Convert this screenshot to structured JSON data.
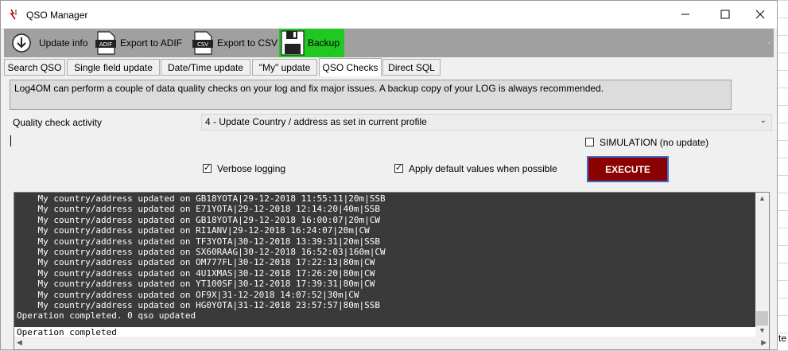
{
  "window": {
    "title": "QSO Manager"
  },
  "background": {
    "right_text": "te"
  },
  "toolbar": {
    "update_info": "Update info",
    "export_adif": "Export to ADIF",
    "export_csv": "Export to CSV",
    "backup": "Backup",
    "end_mark": "-",
    "adif_icon_text": "ADIF",
    "csv_icon_text": "CSV"
  },
  "tabs": [
    "Search QSO",
    "Single field update",
    "Date/Time update",
    "\"My\" update",
    "QSO Checks",
    "Direct SQL"
  ],
  "active_tab": "QSO Checks",
  "info_text": "Log4OM can perform a couple of data quality checks on your log and fix major issues. A backup copy of your LOG is always recommended.",
  "quality_check": {
    "label": "Quality check activity",
    "selected": "4 - Update Country / address as set in current profile"
  },
  "options": {
    "simulation": {
      "label": "SIMULATION (no update)",
      "checked": false
    },
    "verbose": {
      "label": "Verbose logging",
      "checked": true
    },
    "defaults": {
      "label": "Apply default values when possible",
      "checked": true
    }
  },
  "execute_label": "EXECUTE",
  "log": {
    "lines": [
      "    My country/address updated on GB18YOTA|29-12-2018 11:55:11|20m|SSB",
      "    My country/address updated on E71YOTA|29-12-2018 12:14:20|40m|SSB",
      "    My country/address updated on GB18YOTA|29-12-2018 16:00:07|20m|CW",
      "    My country/address updated on RI1ANV|29-12-2018 16:24:07|20m|CW",
      "    My country/address updated on TF3YOTA|30-12-2018 13:39:31|20m|SSB",
      "    My country/address updated on SX60RAAG|30-12-2018 16:52:03|160m|CW",
      "    My country/address updated on OM777FL|30-12-2018 17:22:13|80m|CW",
      "    My country/address updated on 4U1XMAS|30-12-2018 17:26:20|80m|CW",
      "    My country/address updated on YT100SF|30-12-2018 17:39:31|80m|CW",
      "    My country/address updated on OF9X|31-12-2018 14:07:52|30m|CW",
      "    My country/address updated on HG0YOTA|31-12-2018 23:57:57|80m|SSB",
      "Operation completed. 0 qso updated"
    ],
    "status": "Operation completed"
  }
}
